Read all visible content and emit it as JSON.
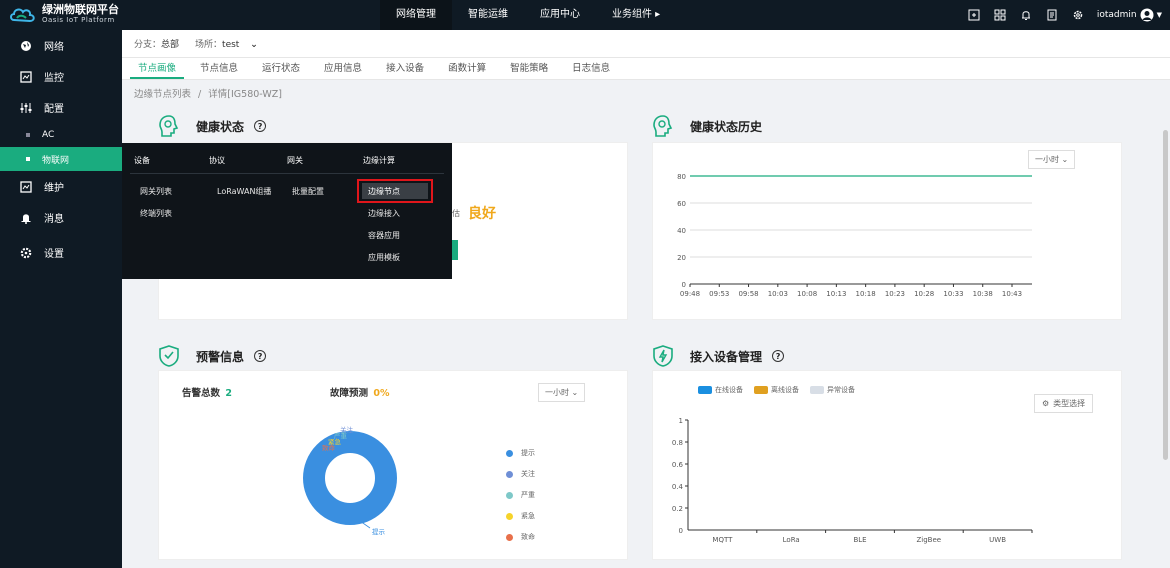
{
  "app": {
    "title": "绿洲物联网平台",
    "subtitle": "Oasis IoT Platform"
  },
  "topnav": {
    "items": [
      "网络管理",
      "智能运维",
      "应用中心",
      "业务组件 ▸"
    ],
    "active": 0,
    "user": "iotadmin"
  },
  "sidebar": {
    "items": [
      {
        "label": "网络",
        "icon": "globe-icon"
      },
      {
        "label": "监控",
        "icon": "monitor-icon"
      },
      {
        "label": "配置",
        "icon": "sliders-icon"
      },
      {
        "label": "AC",
        "sub": true
      },
      {
        "label": "物联网",
        "sub": true,
        "active": true
      },
      {
        "label": "维护",
        "icon": "wrench-icon"
      },
      {
        "label": "消息",
        "icon": "bell-icon"
      },
      {
        "label": "设置",
        "icon": "gear-icon"
      }
    ]
  },
  "filter": {
    "branch_label": "分支：",
    "branch_value": "总部",
    "site_label": "场所：",
    "site_value": "test"
  },
  "tabs": [
    "节点画像",
    "节点信息",
    "运行状态",
    "应用信息",
    "接入设备",
    "函数计算",
    "智能策略",
    "日志信息"
  ],
  "breadcrumb": {
    "parent": "边缘节点列表",
    "sep": "/",
    "current": "详情[IG580-WZ]"
  },
  "health": {
    "title": "健康状态",
    "status_prefix": "估",
    "status": "良好"
  },
  "health_history": {
    "title": "健康状态历史",
    "range": "一小时"
  },
  "alerts": {
    "title": "预警信息",
    "total_label": "告警总数",
    "total_value": "2",
    "forecast_label": "故障预测",
    "forecast_value": "0%",
    "range": "一小时"
  },
  "access": {
    "title": "接入设备管理",
    "type_button": "类型选择"
  },
  "mega_menu": {
    "columns": [
      {
        "head": "设备",
        "items": [
          "网关列表",
          "终端列表"
        ]
      },
      {
        "head": "协议",
        "items": [
          "LoRaWAN组播"
        ]
      },
      {
        "head": "网关",
        "items": [
          "批量配置"
        ]
      },
      {
        "head": "边缘计算",
        "items": [
          "边缘节点",
          "边缘接入",
          "容器应用",
          "应用模板"
        ]
      }
    ],
    "highlighted": "边缘节点"
  },
  "chart_data": [
    {
      "type": "line",
      "title": "健康状态历史",
      "x": [
        "09:48",
        "09:53",
        "09:58",
        "10:03",
        "10:08",
        "10:13",
        "10:18",
        "10:23",
        "10:28",
        "10:33",
        "10:38",
        "10:43"
      ],
      "series": [
        {
          "values": [
            80,
            80,
            80,
            80,
            80,
            80,
            80,
            80,
            80,
            80,
            80,
            80
          ],
          "color": "#1aac7f"
        }
      ],
      "yticks": [
        "80",
        "60",
        "40",
        "20",
        "0"
      ],
      "ylim": [
        0,
        80
      ]
    },
    {
      "type": "pie",
      "slices": [
        {
          "label": "提示",
          "value": 2,
          "color": "#3a8fe0"
        },
        {
          "label": "关注",
          "value": 0,
          "color": "#6f8fd6"
        },
        {
          "label": "严重",
          "value": 0,
          "color": "#7ec8c8"
        },
        {
          "label": "紧急",
          "value": 0,
          "color": "#f6d32a"
        },
        {
          "label": "致命",
          "value": 0,
          "color": "#e8704a"
        }
      ]
    },
    {
      "type": "bar",
      "categories": [
        "MQTT",
        "LoRa",
        "BLE",
        "ZigBee",
        "UWB"
      ],
      "series": [
        {
          "name": "在线设备",
          "values": [
            0,
            0,
            0,
            0,
            0
          ],
          "color": "#1a8fe0"
        },
        {
          "name": "离线设备",
          "values": [
            0,
            0,
            0,
            0,
            0
          ],
          "color": "#e0a020"
        },
        {
          "name": "异常设备",
          "values": [
            0,
            0,
            0,
            0,
            0
          ],
          "color": "#d8dee6"
        }
      ],
      "yticks": [
        "1",
        "0.8",
        "0.6",
        "0.4",
        "0.2",
        "0"
      ],
      "ylim": [
        0,
        1
      ]
    }
  ]
}
